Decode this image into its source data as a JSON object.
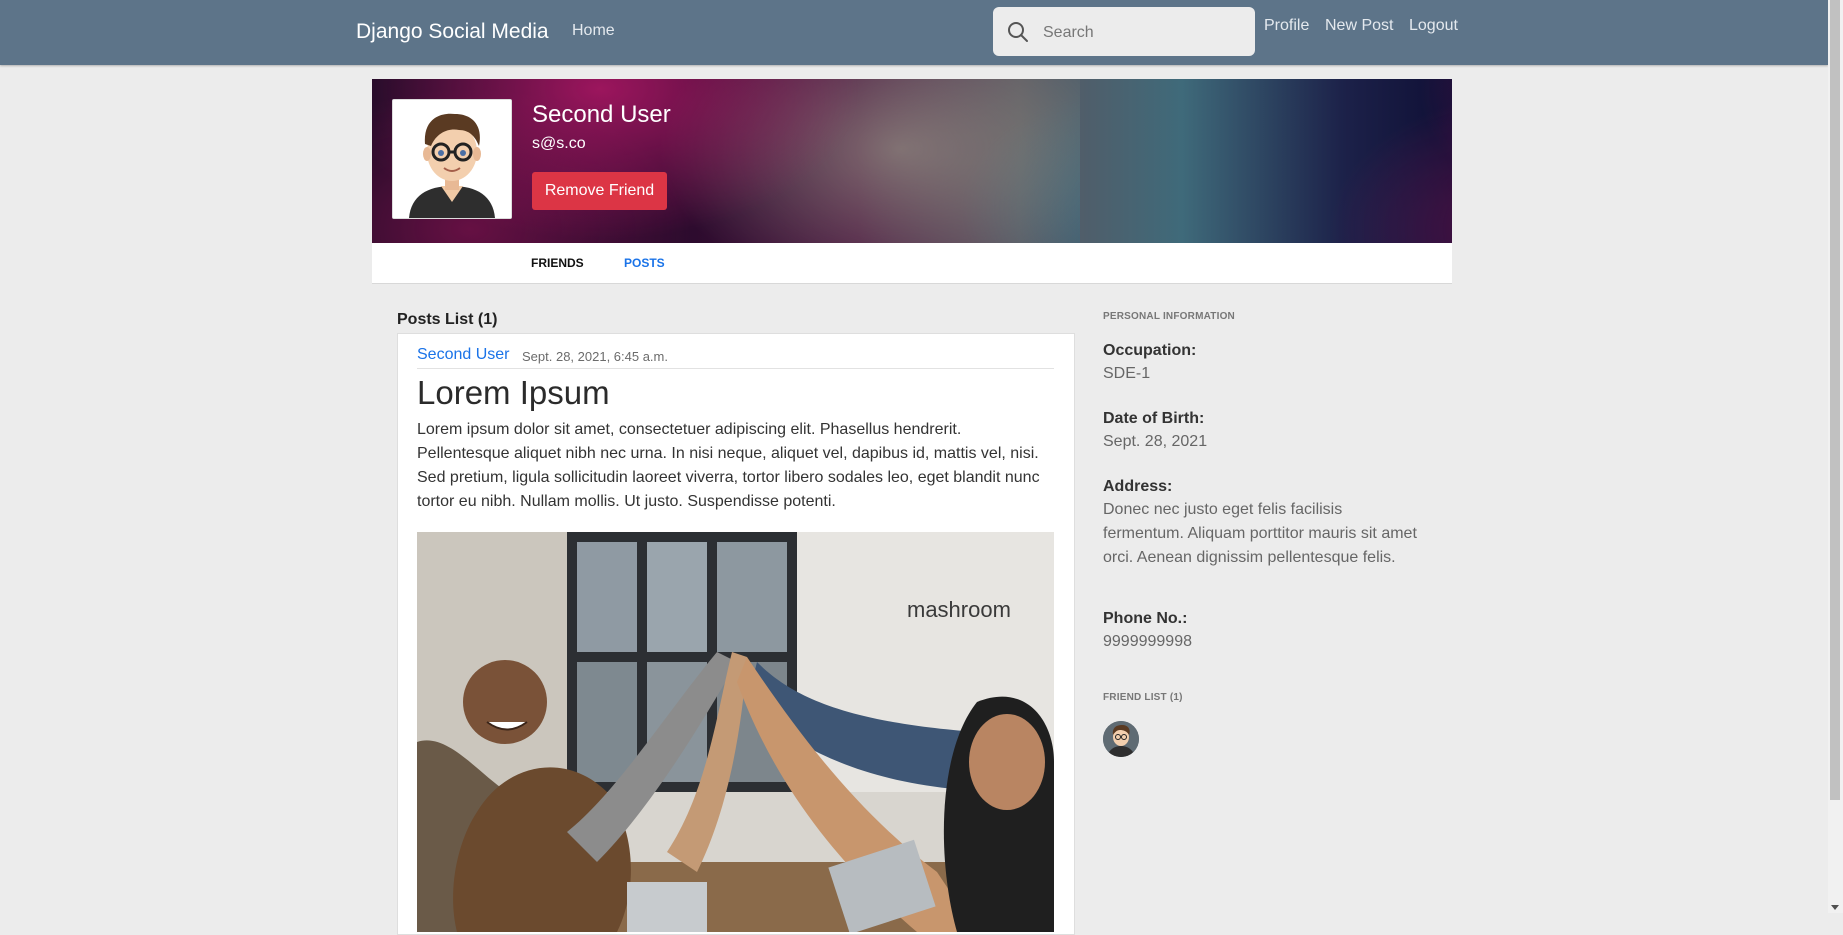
{
  "navbar": {
    "brand": "Django Social Media",
    "home": "Home",
    "search_placeholder": "Search",
    "links": {
      "profile": "Profile",
      "new_post": "New Post",
      "logout": "Logout"
    }
  },
  "profile": {
    "name": "Second User",
    "email": "s@s.co",
    "remove_button": "Remove Friend",
    "tabs": {
      "friends": "FRIENDS",
      "posts": "POSTS"
    }
  },
  "posts": {
    "heading": "Posts List (1)",
    "items": [
      {
        "author": "Second User",
        "date": "Sept. 28, 2021, 6:45 a.m.",
        "title": "Lorem Ipsum",
        "body": "Lorem ipsum dolor sit amet, consectetuer adipiscing elit. Phasellus hendrerit. Pellentesque aliquet nibh nec urna. In nisi neque, aliquet vel, dapibus id, mattis vel, nisi. Sed pretium, ligula sollicitudin laoreet viverra, tortor libero sodales leo, eget blandit nunc tortor eu nibh. Nullam mollis. Ut justo. Suspendisse potenti.",
        "image_sign": "mashroom"
      }
    ]
  },
  "sidebar": {
    "personal_heading": "PERSONAL INFORMATION",
    "occupation_label": "Occupation:",
    "occupation": "SDE-1",
    "dob_label": "Date of Birth:",
    "dob": "Sept. 28, 2021",
    "address_label": "Address:",
    "address": "Donec nec justo eget felis facilisis fermentum. Aliquam porttitor mauris sit amet orci. Aenean dignissim pellentesque felis.",
    "phone_label": "Phone No.:",
    "phone": "9999999998",
    "friend_list_heading": "FRIEND LIST (1)"
  },
  "colors": {
    "navbar": "#5d7489",
    "accent_link": "#1a73e8",
    "danger": "#dc3545",
    "page_bg": "#ececec"
  },
  "icons": [
    "search-icon",
    "avatar",
    "friend-avatar"
  ]
}
